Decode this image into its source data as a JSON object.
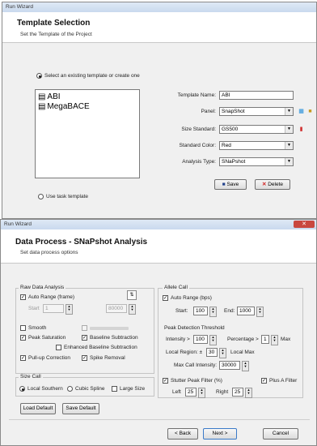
{
  "window1": {
    "title": "Run Wizard",
    "header_title": "Template Selection",
    "header_subtitle": "Set the Template of the Project",
    "select_existing_label": "Select an existing template or create one",
    "templates": [
      {
        "name": "ABI"
      },
      {
        "name": "MegaBACE"
      }
    ],
    "template_name_label": "Template Name:",
    "template_name_value": "ABI",
    "panel_label": "Panel:",
    "panel_value": "SnapShot",
    "size_standard_label": "Size Standard:",
    "size_standard_value": "GS500",
    "standard_color_label": "Standard Color:",
    "standard_color_value": "Red",
    "analysis_type_label": "Analysis Type:",
    "analysis_type_value": "SNaPshot",
    "save_label": "Save",
    "delete_label": "Delete",
    "use_task_label": "Use task template"
  },
  "window2": {
    "title": "Run Wizard",
    "header_title": "Data Process - SNaPshot Analysis",
    "header_subtitle": "Set data process options",
    "raw": {
      "group_label": "Raw Data Analysis",
      "auto_range_label": "Auto Range (frame)",
      "start_label": "Start",
      "start_value": "1",
      "end_value": "80000",
      "smooth_label": "Smooth",
      "peak_saturation_label": "Peak Saturation",
      "baseline_subtraction_label": "Baseline Subtraction",
      "enhanced_baseline_label": "Enhanced Baseline Subtraction",
      "pullup_label": "Pull-up Correction",
      "spike_removal_label": "Spike Removal"
    },
    "size_call": {
      "group_label": "Size Call",
      "local_southern": "Local Southern",
      "cubic_spline": "Cubic Spline",
      "large_size": "Large Size"
    },
    "load_default_label": "Load Default",
    "save_default_label": "Save Default",
    "allele": {
      "group_label": "Allele Call",
      "auto_range_label": "Auto Range (bps)",
      "start_label": "Start:",
      "start_value": "100",
      "end_label": "End:",
      "end_value": "1000",
      "peak_detection_label": "Peak Detection Threshold",
      "intensity_label": "Intensity >",
      "intensity_value": "100",
      "percentage_label": "Percentage >",
      "percentage_value": "1",
      "max_label": "Max",
      "local_region_label": "Local Region: ±",
      "local_region_value": "30",
      "local_max_label": "Local Max",
      "max_call_label": "Max Call Intensity:",
      "max_call_value": "30000",
      "stutter_label": "Stutter Peak Filter (%)",
      "plusa_label": "Plus A Filter",
      "left_label": "Left",
      "left_value": "25",
      "right_label": "Right",
      "right_value": "25"
    },
    "back_label": "< Back",
    "next_label": "Next >",
    "cancel_label": "Cancel"
  }
}
